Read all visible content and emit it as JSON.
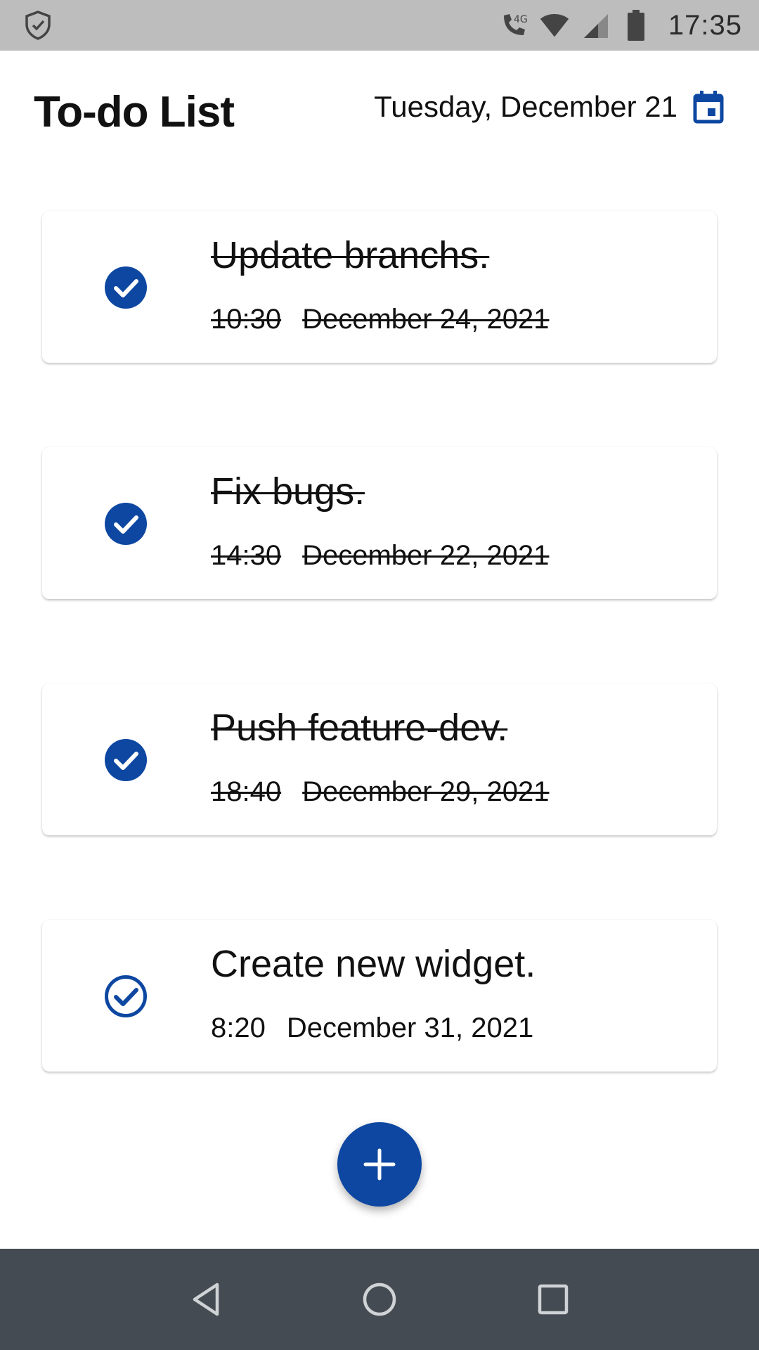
{
  "status_bar": {
    "time": "17:35",
    "network_label": "4G",
    "icons": [
      "shield-icon",
      "call-4g-icon",
      "wifi-icon",
      "cell-signal-icon",
      "battery-icon"
    ]
  },
  "header": {
    "title": "To-do List",
    "date": "Tuesday, December 21",
    "calendar_icon": "calendar-icon"
  },
  "colors": {
    "accent": "#0d47a1",
    "status_bar_bg": "#bdbdbd",
    "nav_bar_bg": "#454b52"
  },
  "tasks": [
    {
      "title": "Update branchs.",
      "time": "10:30",
      "date": "December 24, 2021",
      "completed": true
    },
    {
      "title": "Fix bugs.",
      "time": "14:30",
      "date": "December 22, 2021",
      "completed": true
    },
    {
      "title": "Push feature-dev.",
      "time": "18:40",
      "date": "December 29, 2021",
      "completed": true
    },
    {
      "title": "Create new widget.",
      "time": "8:20",
      "date": "December 31, 2021",
      "completed": false
    }
  ],
  "fab": {
    "icon": "plus-icon"
  },
  "nav_bar": {
    "icons": [
      "back-icon",
      "home-icon",
      "recents-icon"
    ]
  }
}
